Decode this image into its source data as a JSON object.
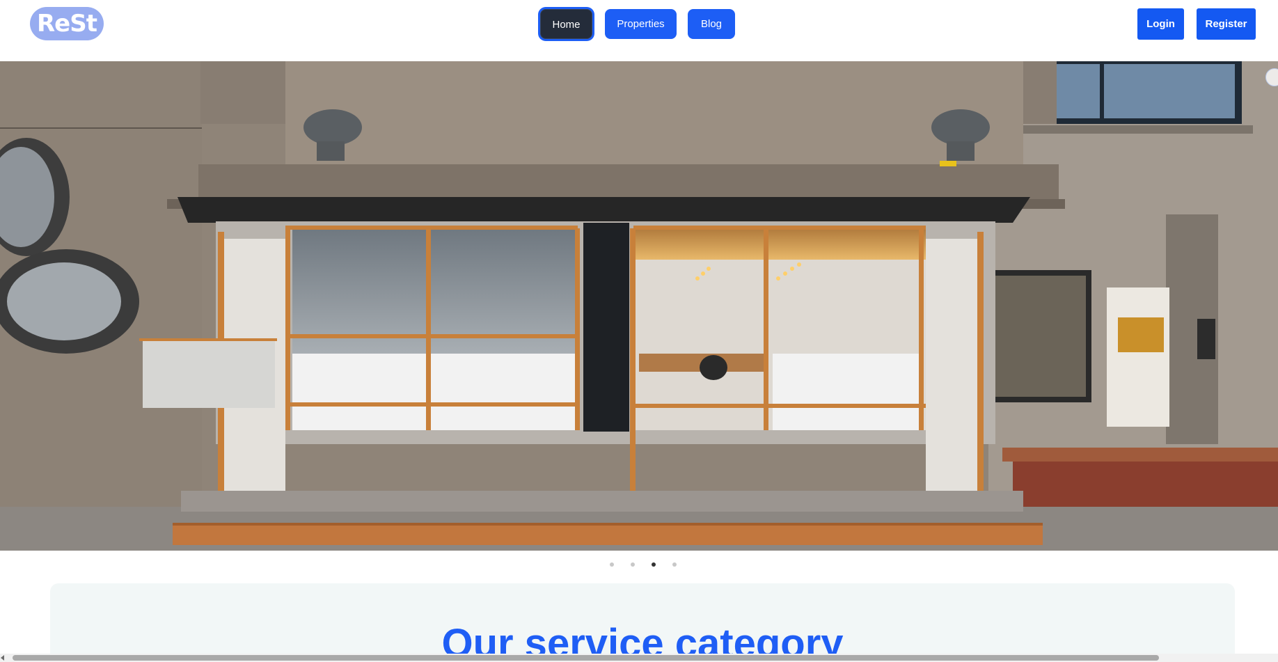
{
  "header": {
    "logo_text": "ReSt",
    "nav": [
      {
        "label": "Home",
        "active": true
      },
      {
        "label": "Properties",
        "active": false
      },
      {
        "label": "Blog",
        "active": false
      }
    ],
    "login_label": "Login",
    "register_label": "Register"
  },
  "carousel": {
    "slide_count": 4,
    "active_index": 2
  },
  "service": {
    "title": "Our service category"
  },
  "colors": {
    "brand_blue": "#1d5ef5",
    "logo_bg": "#97acf0",
    "active_nav": "#242c3a",
    "section_bg": "#f2f7f7"
  }
}
